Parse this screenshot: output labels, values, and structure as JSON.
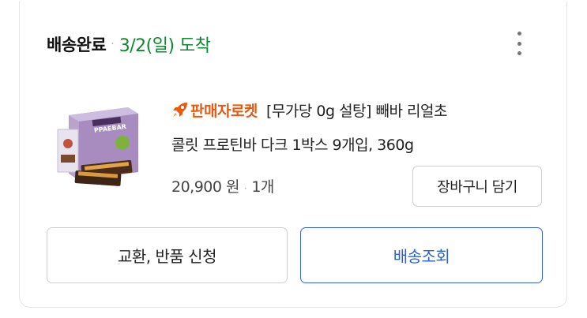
{
  "order": {
    "status": "배송완료",
    "separator": "·",
    "arrival": "3/2(일) 도착",
    "menu_icon": "more-vertical-icon"
  },
  "product": {
    "badge_icon": "rocket-icon",
    "badge": "판매자로켓",
    "title_line1": "[무가당 0g 설탕] 빼바 리얼초",
    "title_line2": "콜릿 프로틴바 다크 1박스 9개입, 360g",
    "price": "20,900 원",
    "price_separator": "·",
    "quantity": "1개",
    "image_text": "PPAEBAR"
  },
  "actions": {
    "add_to_cart": "장바구니 담기",
    "exchange_return": "교환, 반품 신청",
    "track_delivery": "배송조회"
  },
  "colors": {
    "arrival_green": "#0a8a2c",
    "rocket_orange": "#e85a10",
    "track_blue": "#2a5fd0"
  }
}
